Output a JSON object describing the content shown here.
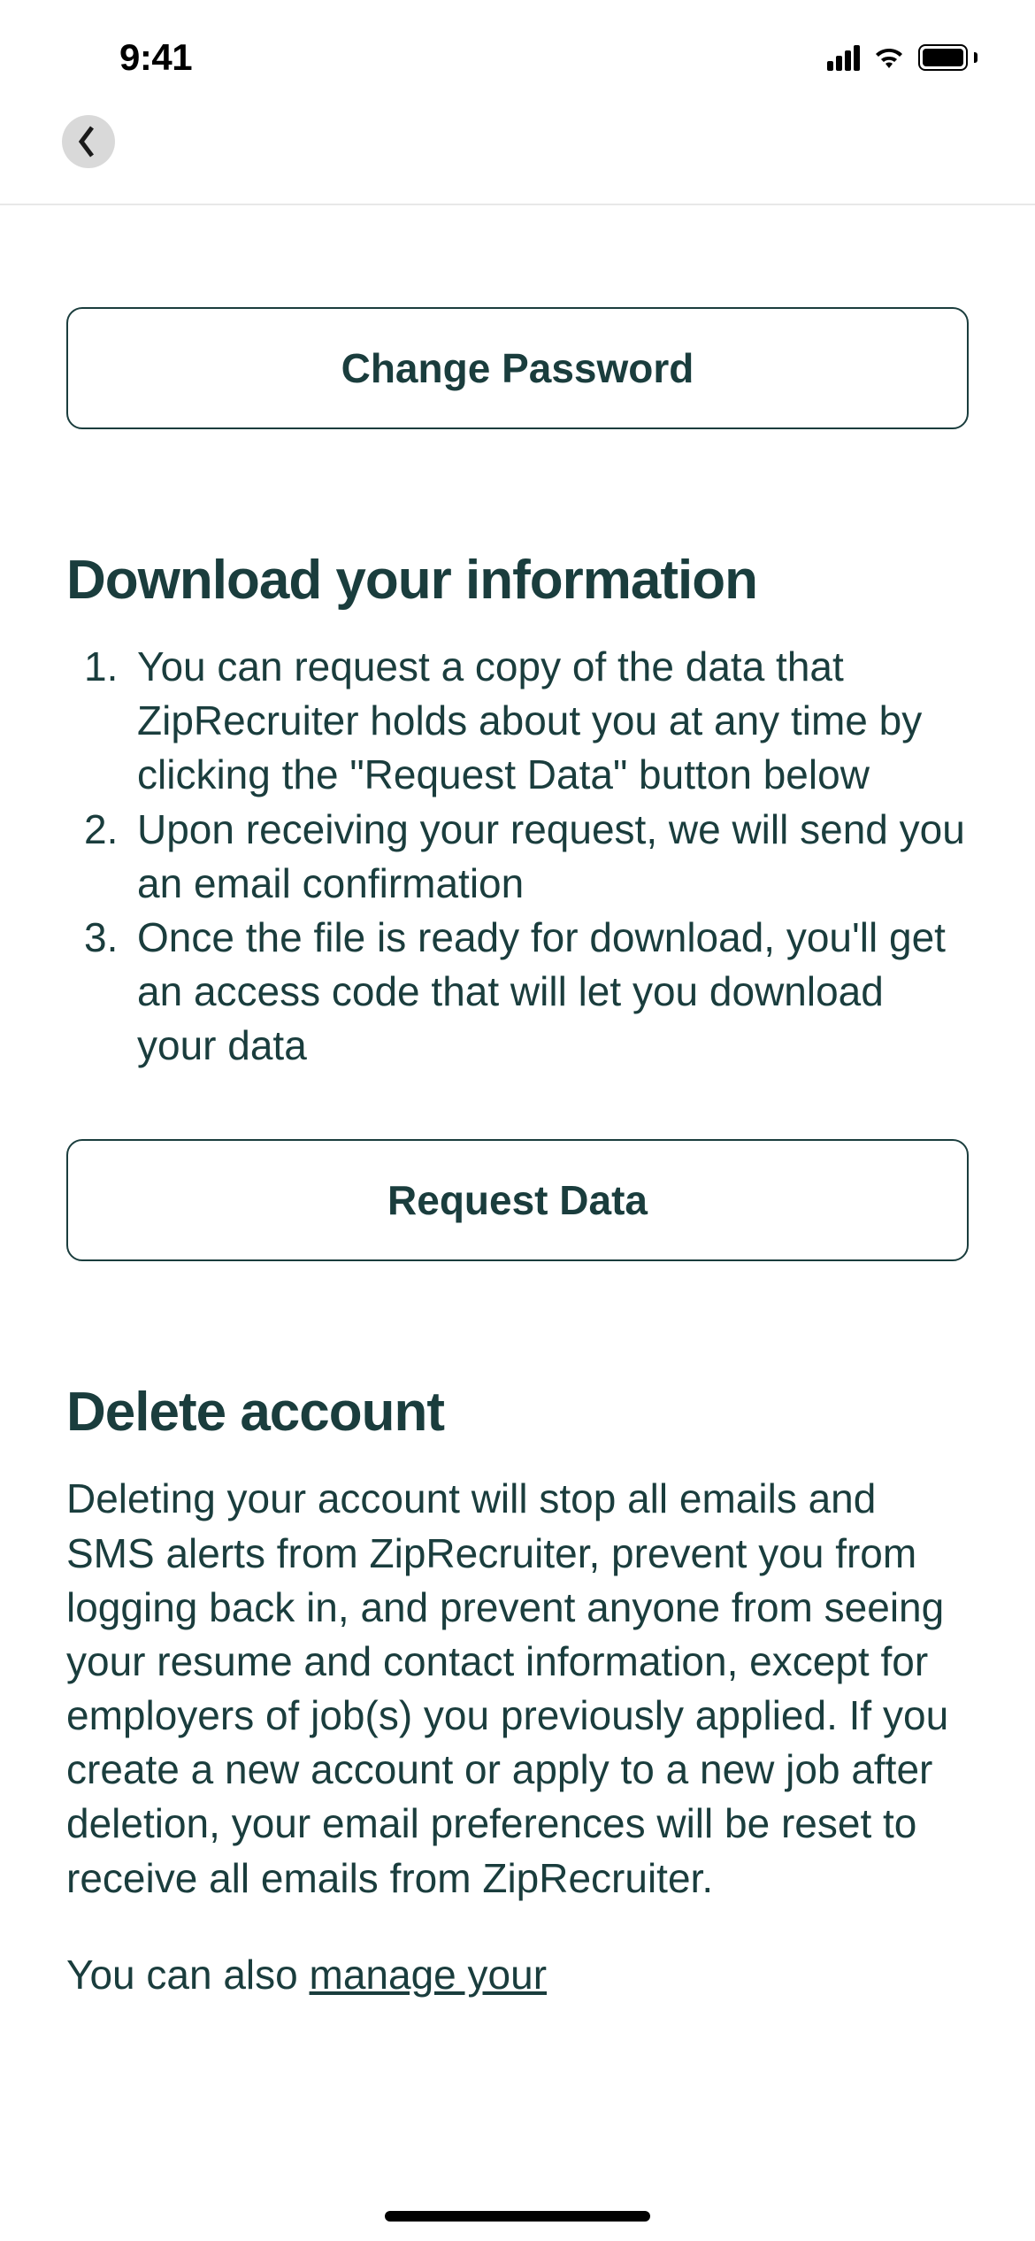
{
  "statusBar": {
    "time": "9:41"
  },
  "buttons": {
    "changePassword": "Change Password",
    "requestData": "Request Data"
  },
  "sections": {
    "download": {
      "title": "Download your information",
      "items": [
        "You can request a copy of the data that ZipRecruiter holds about you at any time by clicking the \"Request Data\" button below",
        "Upon receiving your request, we will send you an email confirmation",
        "Once the file is ready for download, you'll get an access code that will let you download your data"
      ]
    },
    "delete": {
      "title": "Delete account",
      "body": "Deleting your account will stop all emails and SMS alerts from ZipRecruiter, prevent you from logging back in, and prevent anyone from seeing your resume and contact information, except for employers of job(s) you previously applied. If you create a new account or apply to a new job after deletion, your email preferences will be reset to receive all emails from ZipRecruiter.",
      "partialPrefix": "You can also ",
      "partialLink": "manage your"
    }
  }
}
